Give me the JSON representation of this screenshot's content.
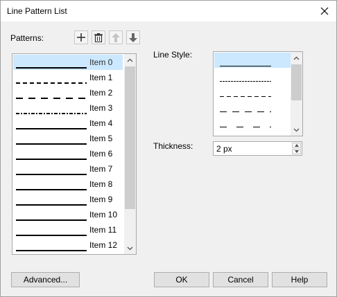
{
  "window": {
    "title": "Line Pattern List"
  },
  "patterns": {
    "label": "Patterns:",
    "toolbar": [
      {
        "icon": "add-icon"
      },
      {
        "icon": "delete-icon"
      },
      {
        "icon": "arrow-up-icon"
      },
      {
        "icon": "arrow-down-icon"
      }
    ],
    "items": [
      {
        "label": "Item 0",
        "style": "solid",
        "selected": true
      },
      {
        "label": "Item 1",
        "style": "dash"
      },
      {
        "label": "Item 2",
        "style": "long-dash"
      },
      {
        "label": "Item 3",
        "style": "dash-dot"
      },
      {
        "label": "Item 4",
        "style": "solid"
      },
      {
        "label": "Item 5",
        "style": "solid"
      },
      {
        "label": "Item 6",
        "style": "solid"
      },
      {
        "label": "Item 7",
        "style": "solid"
      },
      {
        "label": "Item 8",
        "style": "solid"
      },
      {
        "label": "Item 9",
        "style": "solid"
      },
      {
        "label": "Item 10",
        "style": "solid"
      },
      {
        "label": "Item 11",
        "style": "solid"
      },
      {
        "label": "Item 12",
        "style": "solid"
      }
    ]
  },
  "line_style": {
    "label": "Line Style:",
    "options": [
      "solid",
      "fine-dash",
      "dash",
      "long-dash",
      "medium-dash",
      "dash-dot"
    ],
    "selected_index": 0
  },
  "thickness": {
    "label": "Thickness:",
    "value": "2 px"
  },
  "buttons": {
    "advanced": "Advanced...",
    "ok": "OK",
    "cancel": "Cancel",
    "help": "Help"
  },
  "colors": {
    "selection": "#cce8ff",
    "line": "#000000"
  }
}
